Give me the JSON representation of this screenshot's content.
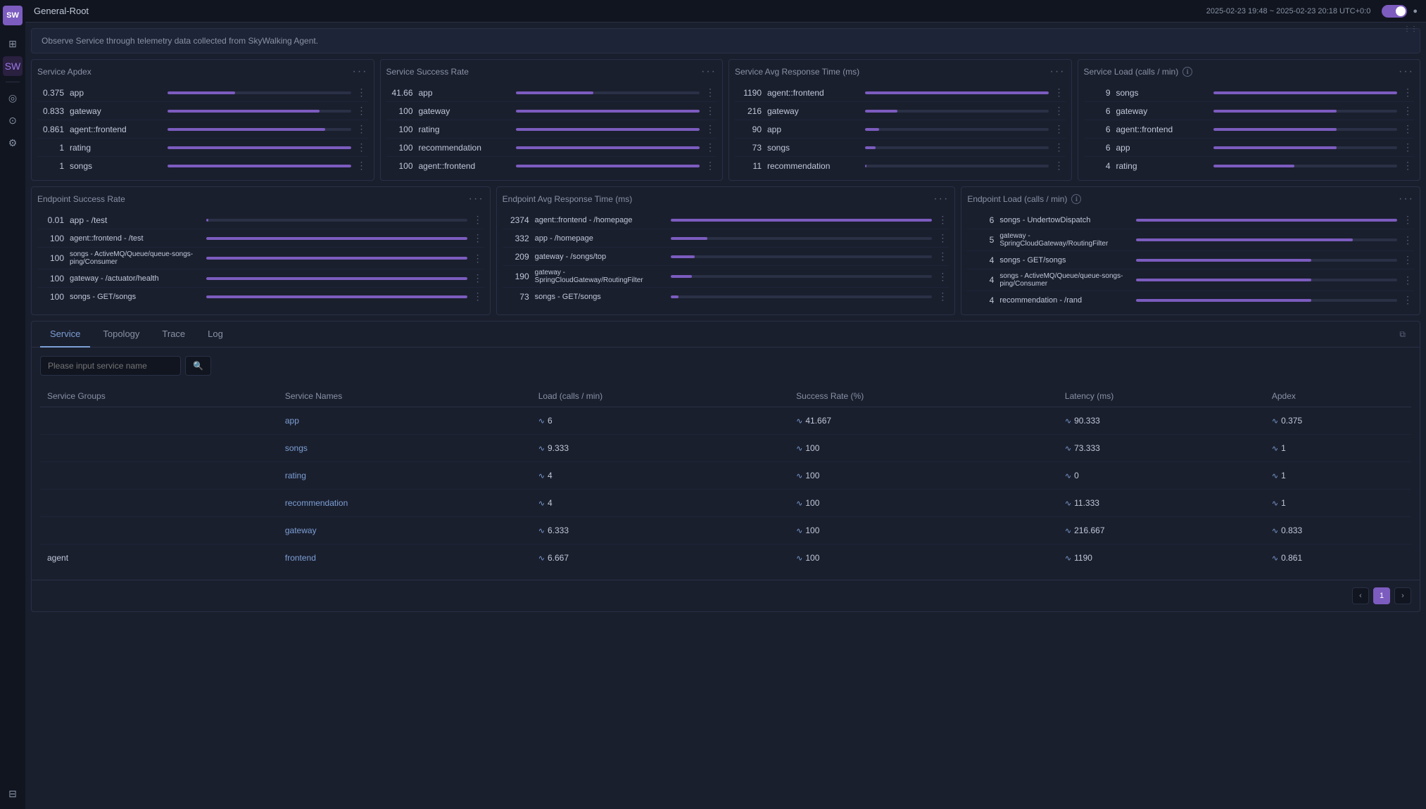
{
  "app": {
    "title": "General-Root"
  },
  "header": {
    "time_range": "2025-02-23 19:48 ~ 2025-02-23 20:18 UTC+0:0"
  },
  "sidebar": {
    "logo": "SW",
    "icons": [
      "⊞",
      "SW",
      "◎",
      "⊙",
      "⚙"
    ]
  },
  "observe_banner": {
    "text": "Observe Service through telemetry data collected from SkyWalking Agent."
  },
  "service_apdex": {
    "title": "Service Apdex",
    "rows": [
      {
        "val": "0.375",
        "name": "app",
        "pct": 37
      },
      {
        "val": "0.833",
        "name": "gateway",
        "pct": 83
      },
      {
        "val": "0.861",
        "name": "agent::frontend",
        "pct": 86
      },
      {
        "val": "1",
        "name": "rating",
        "pct": 100
      },
      {
        "val": "1",
        "name": "songs",
        "pct": 100
      }
    ]
  },
  "service_success_rate": {
    "title": "Service Success Rate",
    "rows": [
      {
        "val": "41.66",
        "name": "app",
        "pct": 42
      },
      {
        "val": "100",
        "name": "gateway",
        "pct": 100
      },
      {
        "val": "100",
        "name": "rating",
        "pct": 100
      },
      {
        "val": "100",
        "name": "recommendation",
        "pct": 100
      },
      {
        "val": "100",
        "name": "agent::frontend",
        "pct": 100
      }
    ]
  },
  "service_avg_response": {
    "title": "Service Avg Response Time (ms)",
    "rows": [
      {
        "val": "1190",
        "name": "agent::frontend",
        "pct": 100
      },
      {
        "val": "216",
        "name": "gateway",
        "pct": 18
      },
      {
        "val": "90",
        "name": "app",
        "pct": 8
      },
      {
        "val": "73",
        "name": "songs",
        "pct": 6
      },
      {
        "val": "11",
        "name": "recommendation",
        "pct": 1
      }
    ]
  },
  "service_load": {
    "title": "Service Load (calls / min)",
    "rows": [
      {
        "val": "9",
        "name": "songs",
        "pct": 100
      },
      {
        "val": "6",
        "name": "gateway",
        "pct": 67
      },
      {
        "val": "6",
        "name": "agent::frontend",
        "pct": 67
      },
      {
        "val": "6",
        "name": "app",
        "pct": 67
      },
      {
        "val": "4",
        "name": "rating",
        "pct": 44
      }
    ]
  },
  "endpoint_success_rate": {
    "title": "Endpoint Success Rate",
    "rows": [
      {
        "val": "0.01",
        "name": "app - /test",
        "pct": 1
      },
      {
        "val": "100",
        "name": "agent::frontend - /test",
        "pct": 100
      },
      {
        "val": "100",
        "name": "songs - ActiveMQ/Queue/queue-songs-ping/Consumer",
        "pct": 100
      },
      {
        "val": "100",
        "name": "gateway - /actuator/health",
        "pct": 100
      },
      {
        "val": "100",
        "name": "songs - GET/songs",
        "pct": 100
      }
    ]
  },
  "endpoint_avg_response": {
    "title": "Endpoint Avg Response Time (ms)",
    "rows": [
      {
        "val": "2374",
        "name": "agent::frontend - /homepage",
        "pct": 100
      },
      {
        "val": "332",
        "name": "app - /homepage",
        "pct": 14
      },
      {
        "val": "209",
        "name": "gateway - /songs/top",
        "pct": 9
      },
      {
        "val": "190",
        "name": "gateway - SpringCloudGateway/RoutingFilter",
        "pct": 8
      },
      {
        "val": "73",
        "name": "songs - GET/songs",
        "pct": 3
      }
    ]
  },
  "endpoint_load": {
    "title": "Endpoint Load (calls / min)",
    "rows": [
      {
        "val": "6",
        "name": "songs - UndertowDispatch",
        "pct": 100
      },
      {
        "val": "5",
        "name": "gateway - SpringCloudGateway/RoutingFilter",
        "pct": 83
      },
      {
        "val": "4",
        "name": "songs - GET/songs",
        "pct": 67
      },
      {
        "val": "4",
        "name": "songs - ActiveMQ/Queue/queue-songs-ping/Consumer",
        "pct": 67
      },
      {
        "val": "4",
        "name": "recommendation - /rand",
        "pct": 67
      }
    ]
  },
  "tabs": {
    "items": [
      "Service",
      "Topology",
      "Trace",
      "Log"
    ],
    "active": 0
  },
  "search": {
    "placeholder": "Please input service name"
  },
  "table": {
    "columns": [
      "Service Groups",
      "Service Names",
      "Load (calls / min)",
      "Success Rate (%)",
      "Latency (ms)",
      "Apdex"
    ],
    "rows": [
      {
        "group": "",
        "name": "app",
        "load": "6",
        "success": "41.667",
        "latency": "90.333",
        "apdex": "0.375"
      },
      {
        "group": "",
        "name": "songs",
        "load": "9.333",
        "success": "100",
        "latency": "73.333",
        "apdex": "1"
      },
      {
        "group": "",
        "name": "rating",
        "load": "4",
        "success": "100",
        "latency": "0",
        "apdex": "1"
      },
      {
        "group": "",
        "name": "recommendation",
        "load": "4",
        "success": "100",
        "latency": "11.333",
        "apdex": "1"
      },
      {
        "group": "",
        "name": "gateway",
        "load": "6.333",
        "success": "100",
        "latency": "216.667",
        "apdex": "0.833"
      },
      {
        "group": "agent",
        "name": "frontend",
        "load": "6.667",
        "success": "100",
        "latency": "1190",
        "apdex": "0.861"
      }
    ]
  },
  "pagination": {
    "prev": "‹",
    "page": "1",
    "next": "›"
  }
}
